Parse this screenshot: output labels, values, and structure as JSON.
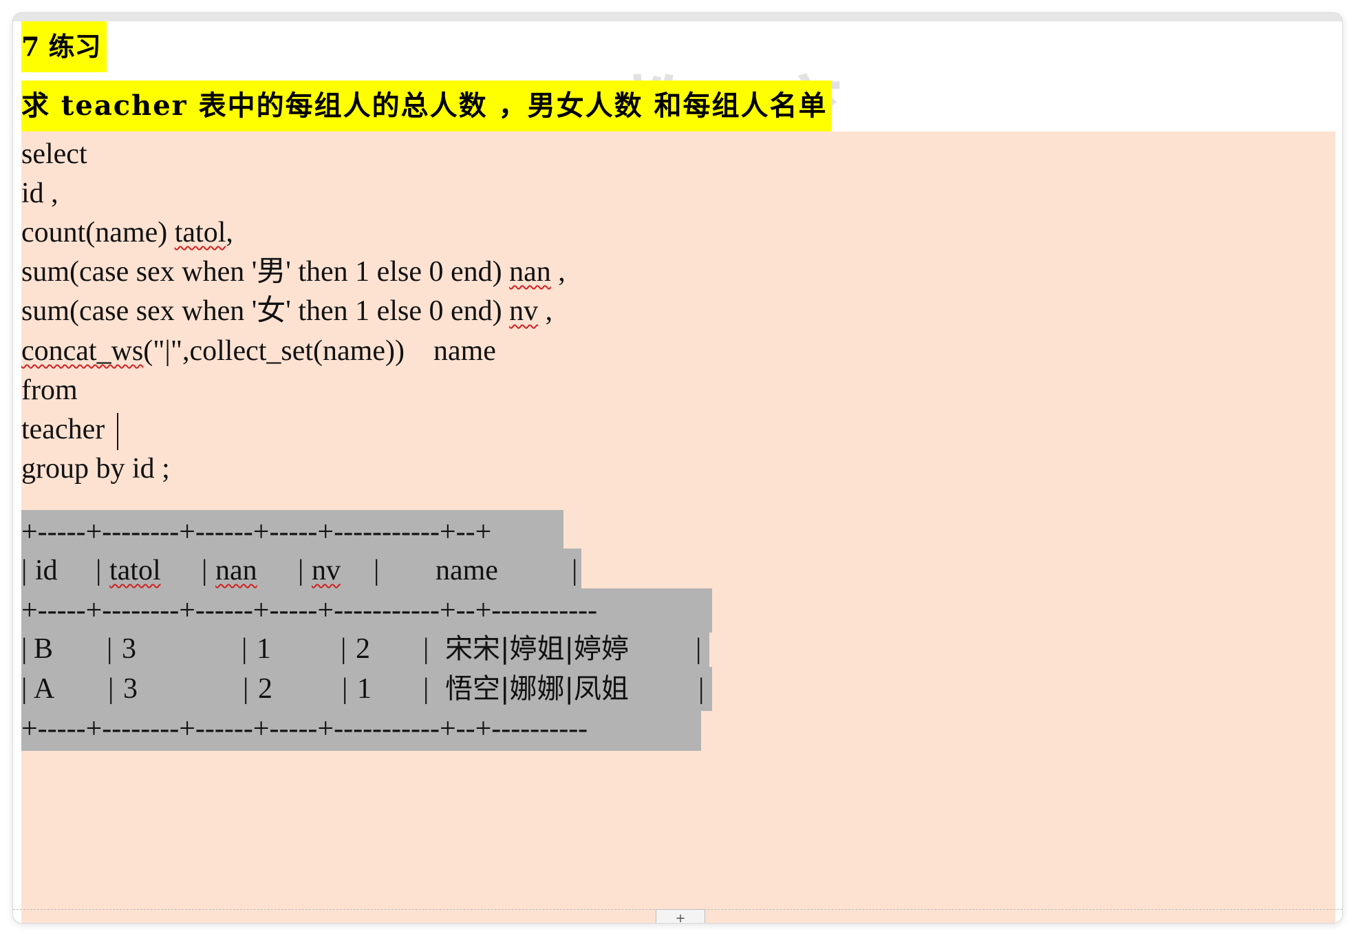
{
  "heading": {
    "section": "7 练习",
    "task": "求 teacher 表中的每组人的总人数 ，男女人数  和每组人名单"
  },
  "watermark": {
    "text": "教 育"
  },
  "sql": {
    "l1": "select",
    "l2": "id ,",
    "l3a": "count(name) ",
    "l3b": "tatol",
    "l3c": ",",
    "l4a": "sum(case sex when '男' then 1 else 0 end) ",
    "l4b": "nan",
    "l4c": " ,",
    "l5a": "sum(case sex when '女' then 1 else 0 end) ",
    "l5b": "nv",
    "l5c": " ,",
    "l6a": "concat_ws",
    "l6b": "(\"|\",collect_set(name))    name",
    "l7": "from",
    "l8": "teacher",
    "l9": "group by id ;"
  },
  "result": {
    "border_top": "+-----+--------+------+-----+-----------+--+",
    "header": {
      "bar1": "|",
      "id": "id",
      "bar2": "|",
      "tatol": "tatol",
      "bar3": "|",
      "nan": "nan",
      "bar4": "|",
      "nv": "nv",
      "bar5": "|",
      "name": "name",
      "bar6": "|"
    },
    "border_mid": "+-----+--------+------+-----+-----------+--+-----------",
    "rows": [
      {
        "id": "B",
        "tatol": "3",
        "nan": "1",
        "nv": "2",
        "name": "宋宋|婷姐|婷婷"
      },
      {
        "id": "A",
        "tatol": "3",
        "nan": "2",
        "nv": "1",
        "name": "悟空|娜娜|凤姐"
      }
    ],
    "border_bottom": "+-----+--------+------+-----+-----------+--+----------"
  },
  "footer": {
    "tab_label": "+"
  },
  "colors": {
    "highlight": "#ffff00",
    "code_background": "#fde2d2",
    "result_background": "#b3b3b3"
  }
}
